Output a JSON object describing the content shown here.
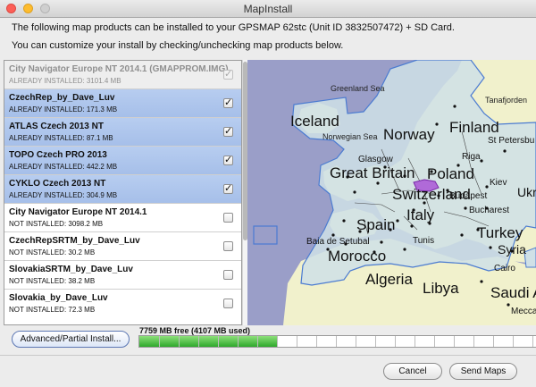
{
  "window": {
    "title": "MapInstall"
  },
  "message": {
    "line1": "The following map products can be installed to your GPSMAP 62stc (Unit ID 3832507472) + SD Card.",
    "line2": "You can customize your install by checking/unchecking map products below."
  },
  "products": [
    {
      "name": "City Navigator Europe NT 2014.1 (GMAPPROM.IMG)",
      "status": "ALREADY INSTALLED: 3101.4 MB",
      "checked": true,
      "state": "disabled"
    },
    {
      "name": "CzechRep_by_Dave_Luv",
      "status": "ALREADY INSTALLED: 171.3 MB",
      "checked": true,
      "state": "installed"
    },
    {
      "name": "ATLAS Czech 2013 NT",
      "status": "ALREADY INSTALLED: 87.1 MB",
      "checked": true,
      "state": "installed"
    },
    {
      "name": "TOPO Czech PRO 2013",
      "status": "ALREADY INSTALLED: 442.2 MB",
      "checked": true,
      "state": "installed"
    },
    {
      "name": "CYKLO Czech 2013 NT",
      "status": "ALREADY INSTALLED: 304.9 MB",
      "checked": true,
      "state": "installed"
    },
    {
      "name": "City Navigator Europe NT 2014.1",
      "status": "NOT INSTALLED: 3098.2 MB",
      "checked": false,
      "state": "normal"
    },
    {
      "name": "CzechRepSRTM_by_Dave_Luv",
      "status": "NOT INSTALLED: 30.2 MB",
      "checked": false,
      "state": "normal"
    },
    {
      "name": "SlovakiaSRTM_by_Dave_Luv",
      "status": "NOT INSTALLED: 38.2 MB",
      "checked": false,
      "state": "normal"
    },
    {
      "name": "Slovakia_by_Dave_Luv",
      "status": "NOT INSTALLED: 72.3 MB",
      "checked": false,
      "state": "normal"
    }
  ],
  "map": {
    "labels": {
      "greenland_sea": "Greenland Sea",
      "tanafjorden": "Tanafjorden",
      "iceland": "Iceland",
      "norwegian_sea": "Norwegian Sea",
      "norway": "Norway",
      "finland": "Finland",
      "st_petersburg": "St Petersbu",
      "glasgow": "Glasgow",
      "riga": "Riga",
      "great_britain": "Great Britain",
      "poland": "Poland",
      "kiev": "Kiev",
      "switzerland": "Switzerland",
      "budapest": "Budapest",
      "ukraine": "Ukr",
      "bucharest": "Bucharest",
      "spain": "Spain",
      "italy": "Italy",
      "baia_de_setubal": "Baia de Setubal",
      "tunis": "Tunis",
      "turkey": "Turkey",
      "syria": "Syria",
      "morocco": "Morocco",
      "cairo": "Cairo",
      "algeria": "Algeria",
      "libya": "Libya",
      "saudi_arabia": "Saudi Ar",
      "mecca": "Mecca"
    }
  },
  "toolbar": {
    "advanced_label": "Advanced/Partial Install..."
  },
  "storage": {
    "free_text": "7759 MB free (4107 MB used)",
    "used_fraction": 0.35
  },
  "footer": {
    "cancel_label": "Cancel",
    "send_label": "Send Maps"
  },
  "colors": {
    "installed_row": "#a6bfe9",
    "progress": "#2ea82b",
    "sea": "#9a9ec8",
    "land": "#f1f1cc",
    "coverage": "#cfe0e6",
    "coverage_border": "#4b7bd1"
  }
}
